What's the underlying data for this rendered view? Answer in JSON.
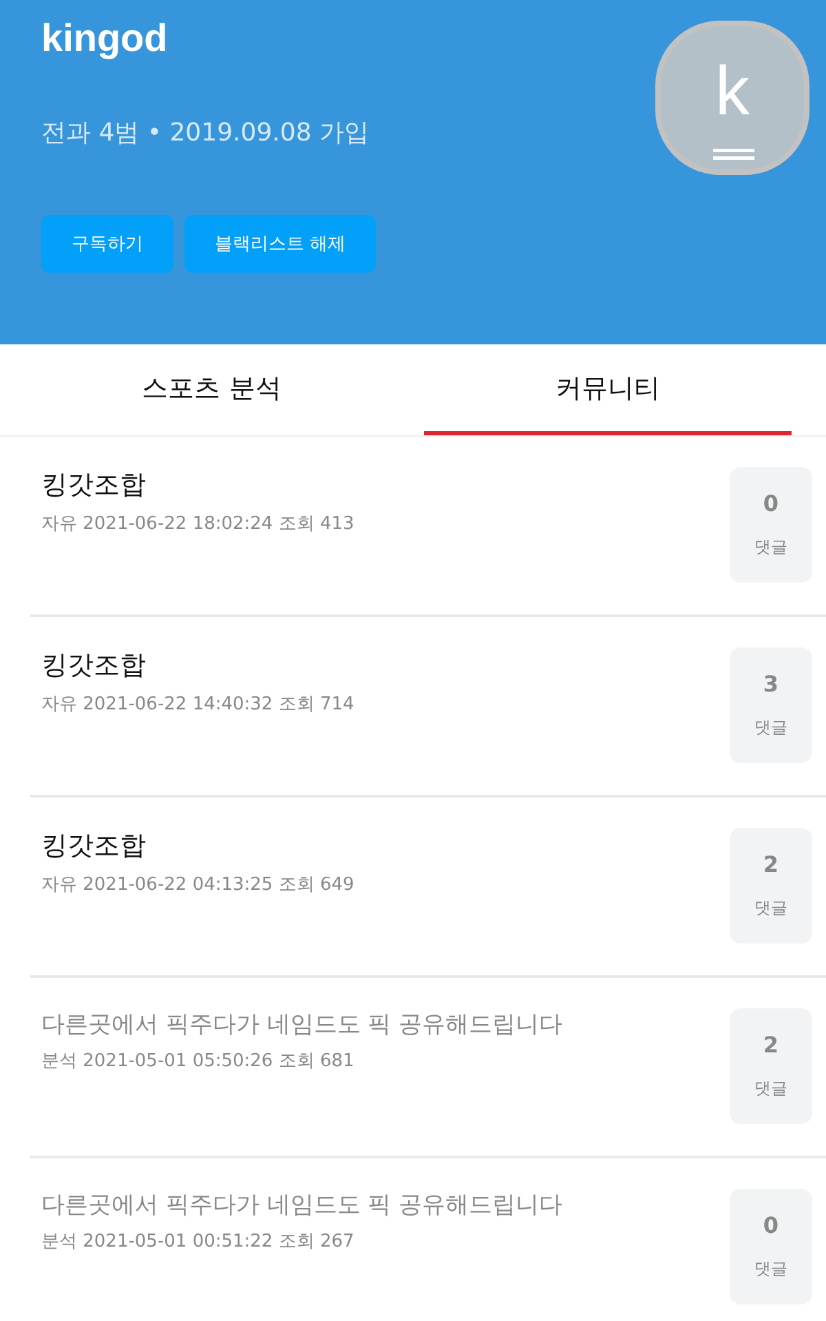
{
  "profile": {
    "name": "kingod",
    "stats": "전과 4범 • 2019.09.08 가입",
    "avatar_letter": "k",
    "buttons": [
      "구독하기",
      "블랙리스트 해제"
    ]
  },
  "tabs": [
    {
      "label": "스포츠 분석",
      "selected": false
    },
    {
      "label": "커뮤니티",
      "selected": true
    }
  ],
  "posts": [
    {
      "title": "킹갓조합",
      "meta": "자유 2021-06-22 18:02:24 조회 413",
      "comments": "0",
      "comments_label": "댓글",
      "read": false
    },
    {
      "title": "킹갓조합",
      "meta": "자유 2021-06-22 14:40:32 조회 714",
      "comments": "3",
      "comments_label": "댓글",
      "read": false
    },
    {
      "title": "킹갓조합",
      "meta": "자유 2021-06-22 04:13:25 조회 649",
      "comments": "2",
      "comments_label": "댓글",
      "read": false
    },
    {
      "title": "다른곳에서 픽주다가 네임드도 픽 공유해드립니다",
      "meta": "분석 2021-05-01 05:50:26 조회 681",
      "comments": "2",
      "comments_label": "댓글",
      "read": true
    },
    {
      "title": "다른곳에서 픽주다가 네임드도 픽 공유해드립니다",
      "meta": "분석 2021-05-01 00:51:22 조회 267",
      "comments": "0",
      "comments_label": "댓글",
      "read": true
    }
  ]
}
